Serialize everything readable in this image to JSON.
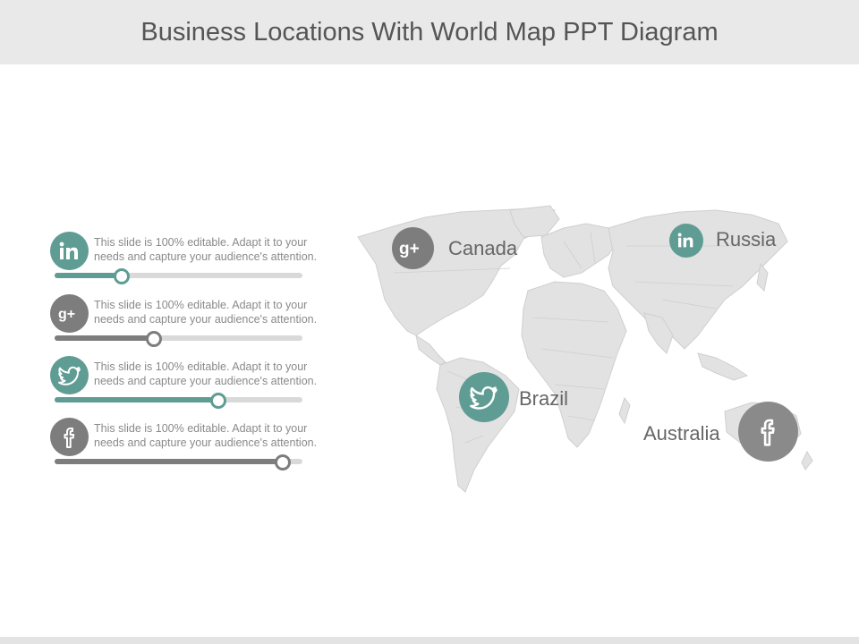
{
  "title": "Business Locations With World Map PPT Diagram",
  "colors": {
    "teal": "#5f9c94",
    "gray": "#7d7d7d",
    "track": "#d9d9d9",
    "map": "#e2e2e2",
    "map_border": "#cfcfcf"
  },
  "rows": [
    {
      "icon": "linkedin-icon",
      "text_line1": "This slide is 100% editable. Adapt it to your",
      "text_line2": "needs and capture your audience's attention.",
      "progress": 0.27,
      "color": "#5f9c94"
    },
    {
      "icon": "google-plus-icon",
      "text_line1": "This slide is 100% editable. Adapt it to your",
      "text_line2": "needs and capture your audience's attention.",
      "progress": 0.4,
      "color": "#7d7d7d"
    },
    {
      "icon": "twitter-icon",
      "text_line1": "This slide is 100% editable. Adapt it to your",
      "text_line2": "needs and capture your audience's attention.",
      "progress": 0.66,
      "color": "#5f9c94"
    },
    {
      "icon": "facebook-icon",
      "text_line1": "This slide is 100% editable. Adapt it to your",
      "text_line2": "needs and capture your audience's attention.",
      "progress": 0.92,
      "color": "#7d7d7d"
    }
  ],
  "locations": [
    {
      "name": "Canada",
      "icon": "google-plus-icon",
      "color": "#7d7d7d"
    },
    {
      "name": "Russia",
      "icon": "linkedin-icon",
      "color": "#5f9c94"
    },
    {
      "name": "Brazil",
      "icon": "twitter-icon",
      "color": "#5f9c94"
    },
    {
      "name": "Australia",
      "icon": "facebook-icon",
      "color": "#7d7d7d"
    }
  ]
}
